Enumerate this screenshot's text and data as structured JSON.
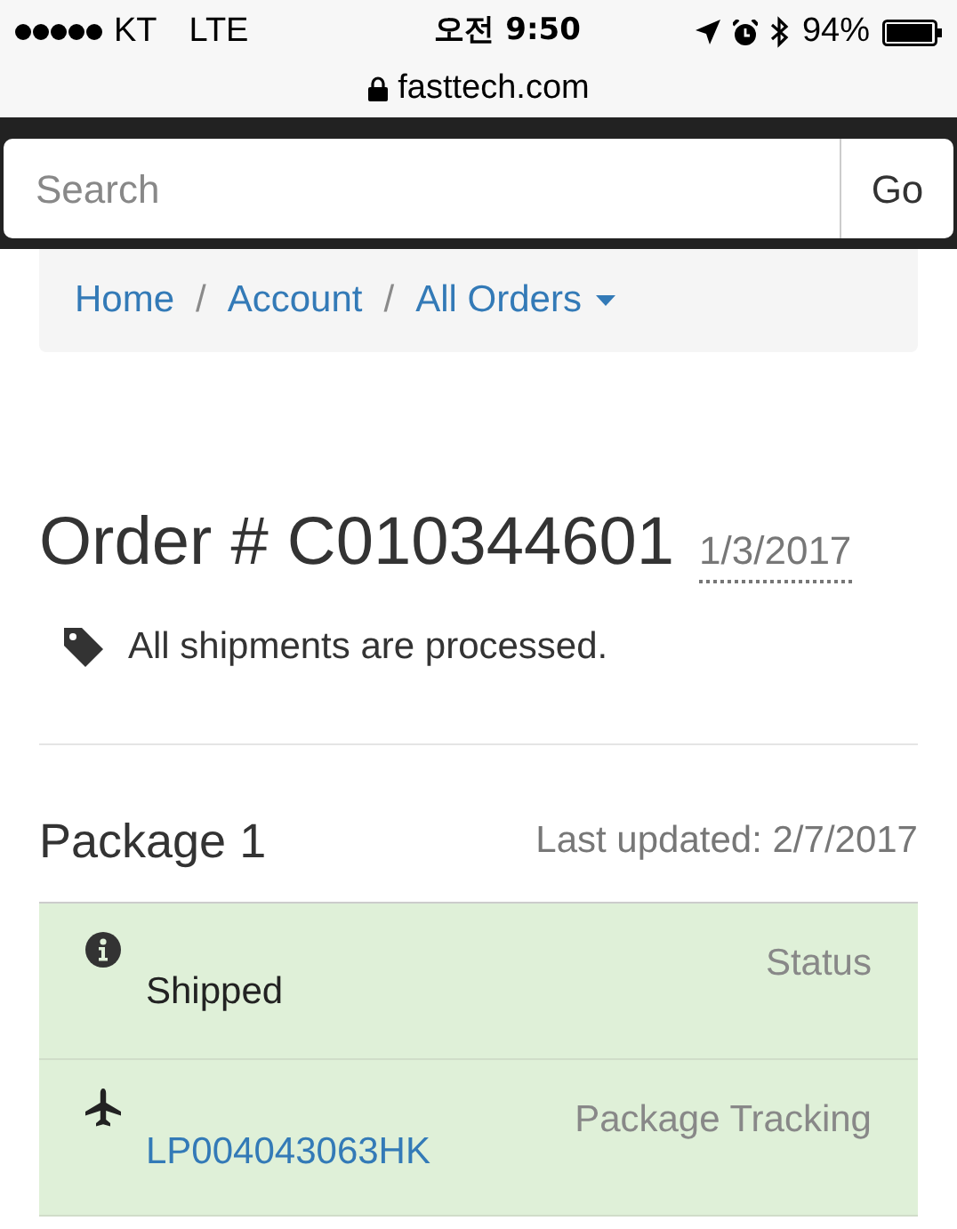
{
  "status_bar": {
    "carrier": "KT",
    "network": "LTE",
    "time": "오전 9:50",
    "battery": "94%"
  },
  "address_bar": {
    "url": "fasttech.com"
  },
  "search": {
    "placeholder": "Search",
    "button": "Go"
  },
  "breadcrumb": {
    "separator": "/",
    "items": [
      {
        "label": "Home",
        "dropdown": false
      },
      {
        "label": "Account",
        "dropdown": false
      },
      {
        "label": "All Orders",
        "dropdown": true
      }
    ]
  },
  "order": {
    "title": "Order # C010344601",
    "date": "1/3/2017",
    "note": "All shipments are processed."
  },
  "package": {
    "title": "Package 1",
    "updated": "Last updated: 2/7/2017",
    "rows": [
      {
        "kind": "status",
        "value": "Shipped",
        "label": "Status"
      },
      {
        "kind": "tracking",
        "value": "LP004043063HK",
        "label": "Package Tracking"
      }
    ]
  }
}
